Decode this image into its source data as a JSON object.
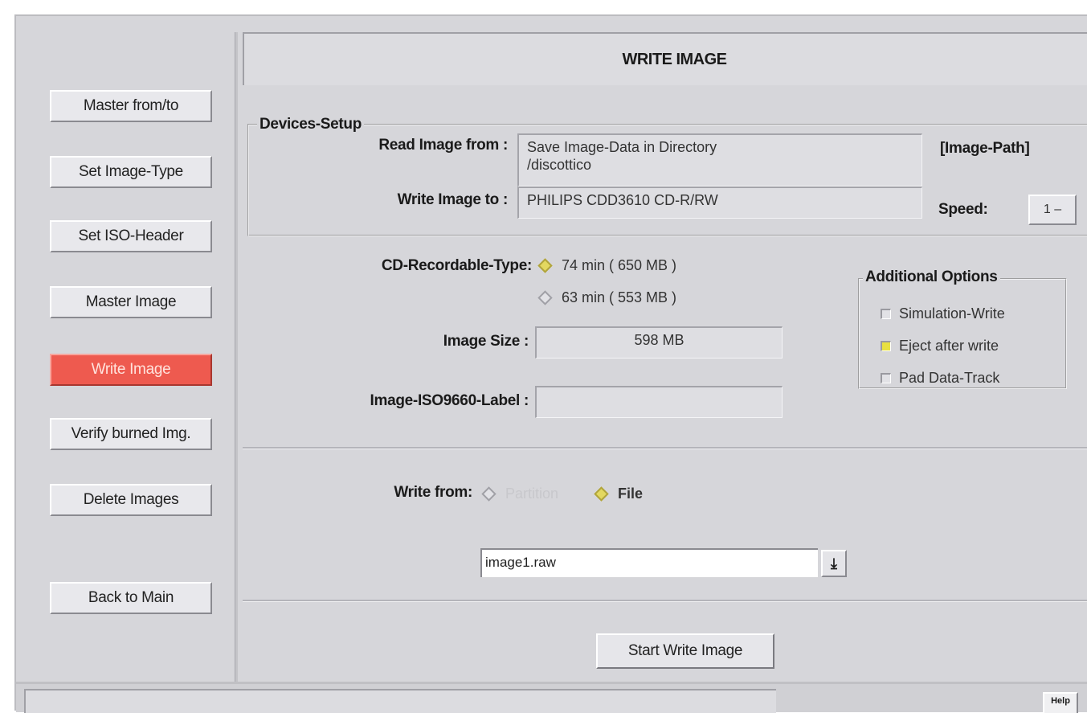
{
  "sidebar": {
    "items": [
      {
        "label": "Master from/to"
      },
      {
        "label": "Set Image-Type"
      },
      {
        "label": "Set ISO-Header"
      },
      {
        "label": "Master Image"
      },
      {
        "label": "Write Image",
        "active": true
      },
      {
        "label": "Verify burned Img."
      },
      {
        "label": "Delete Images"
      },
      {
        "label": "Back to Main"
      }
    ]
  },
  "header": {
    "title": "WRITE IMAGE"
  },
  "devices": {
    "legend": "Devices-Setup",
    "read_label": "Read Image from :",
    "read_value_line1": "Save Image-Data in Directory",
    "read_value_line2": "/discottico",
    "write_label": "Write Image to :",
    "write_value": "PHILIPS  CDD3610 CD-R/RW",
    "image_path_label": "[Image-Path]",
    "speed_label": "Speed:",
    "speed_value": "1 –"
  },
  "cd_type": {
    "label": "CD-Recordable-Type:",
    "options": [
      {
        "label": "74 min ( 650 MB )",
        "selected": true
      },
      {
        "label": "63 min ( 553 MB )",
        "selected": false
      }
    ]
  },
  "image_size": {
    "label": "Image Size :",
    "value": "598 MB"
  },
  "iso_label": {
    "label": "Image-ISO9660-Label :",
    "value": ""
  },
  "additional": {
    "legend": "Additional Options",
    "options": [
      {
        "label": "Simulation-Write",
        "checked": false
      },
      {
        "label": "Eject after write",
        "checked": true
      },
      {
        "label": "Pad Data-Track",
        "checked": false
      }
    ]
  },
  "write_from": {
    "label": "Write from:",
    "options": [
      {
        "label": "Partition",
        "selected": false,
        "disabled": true
      },
      {
        "label": "File",
        "selected": true
      }
    ],
    "file_value": "image1.raw",
    "download_icon": "download-icon"
  },
  "actions": {
    "start_label": "Start Write Image"
  },
  "status": {
    "help_label": "Help"
  },
  "colors": {
    "active_button": "#ee5a4f",
    "panel": "#d6d6da",
    "radio_on": "#e3d860"
  }
}
